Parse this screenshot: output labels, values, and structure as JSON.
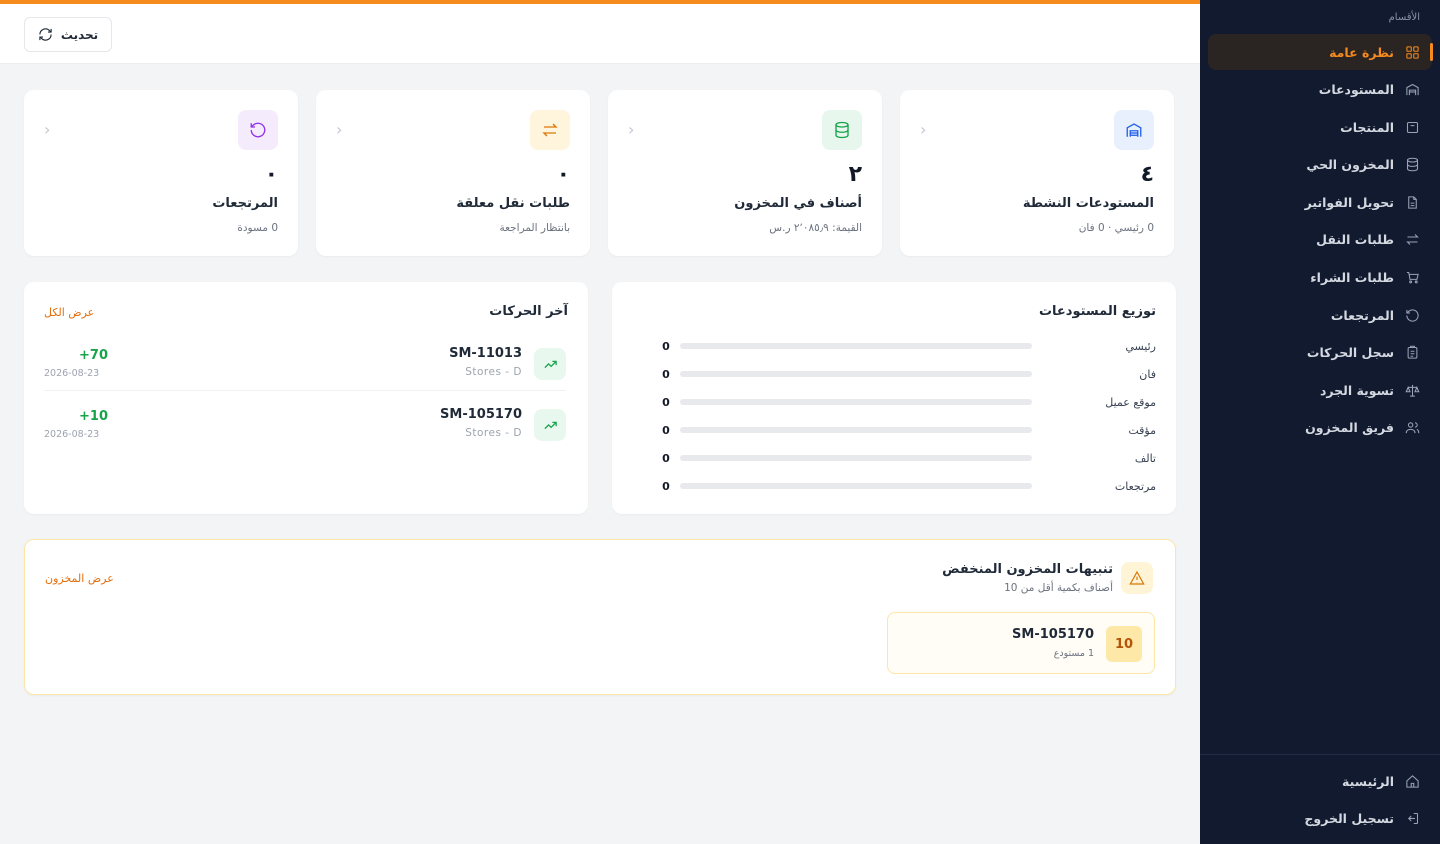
{
  "sidebar": {
    "section_label": "الأقسام",
    "items": [
      {
        "label": "نظرة عامة",
        "icon": "grid-icon",
        "active": true
      },
      {
        "label": "المستودعات",
        "icon": "warehouse-icon"
      },
      {
        "label": "المنتجات",
        "icon": "package-icon"
      },
      {
        "label": "المخزون الحي",
        "icon": "database-icon"
      },
      {
        "label": "تحويل الفواتير",
        "icon": "file-icon"
      },
      {
        "label": "طلبات النقل",
        "icon": "transfer-icon"
      },
      {
        "label": "طلبات الشراء",
        "icon": "cart-icon"
      },
      {
        "label": "المرتجعات",
        "icon": "return-icon"
      },
      {
        "label": "سجل الحركات",
        "icon": "clipboard-icon"
      },
      {
        "label": "تسوية الجرد",
        "icon": "scale-icon"
      },
      {
        "label": "فريق المخزون",
        "icon": "users-icon"
      }
    ],
    "bottom": [
      {
        "label": "الرئيسية",
        "icon": "home-icon"
      },
      {
        "label": "تسجيل الخروج",
        "icon": "logout-icon"
      }
    ]
  },
  "topbar": {
    "refresh_label": "تحديث"
  },
  "stats": [
    {
      "title": "المستودعات النشطة",
      "value": "٤",
      "sub": "0 رئيسي · 0 فان",
      "icon": "warehouse-icon",
      "color": "#2563eb",
      "bg": "#e8f0fe"
    },
    {
      "title": "أصناف في المخزون",
      "value": "٢",
      "sub": "القيمة: ٢٬٠٨٥٫٩ ر.س",
      "icon": "database-icon",
      "color": "#16a34a",
      "bg": "#e7f7ee"
    },
    {
      "title": "طلبات نقل معلقة",
      "value": "٠",
      "sub": "بانتظار المراجعة",
      "icon": "transfer-icon",
      "color": "#d97706",
      "bg": "#fff4dc"
    },
    {
      "title": "المرتجعات",
      "value": "٠",
      "sub": "0 مسودة",
      "icon": "return-icon",
      "color": "#9333ea",
      "bg": "#f4ecfd"
    }
  ],
  "distribution": {
    "title": "توزيع المستودعات",
    "rows": [
      {
        "label": "رئيسي",
        "value": 0
      },
      {
        "label": "فان",
        "value": 0
      },
      {
        "label": "موقع عميل",
        "value": 0
      },
      {
        "label": "مؤقت",
        "value": 0
      },
      {
        "label": "تالف",
        "value": 0
      },
      {
        "label": "مرتجعات",
        "value": 0
      }
    ]
  },
  "moves": {
    "title": "آخر الحركات",
    "view_all": "عرض الكل",
    "items": [
      {
        "code": "SM-11013",
        "location": "Stores - D",
        "qty": "+70",
        "date": "2026-08-23"
      },
      {
        "code": "SM-105170",
        "location": "Stores - D",
        "qty": "+10",
        "date": "2026-08-23"
      }
    ]
  },
  "low_stock": {
    "title": "تنبيهات المخزون المنخفض",
    "subtitle": "أصناف بكمية أقل من 10",
    "view_link": "عرض المخزون",
    "items": [
      {
        "code": "SM-105170",
        "qty": "10",
        "sub": "1 مستودع"
      }
    ]
  },
  "colors": {
    "accent": "#f58a1f",
    "sidebar_bg": "#111a2e",
    "positive": "#16a34a"
  }
}
